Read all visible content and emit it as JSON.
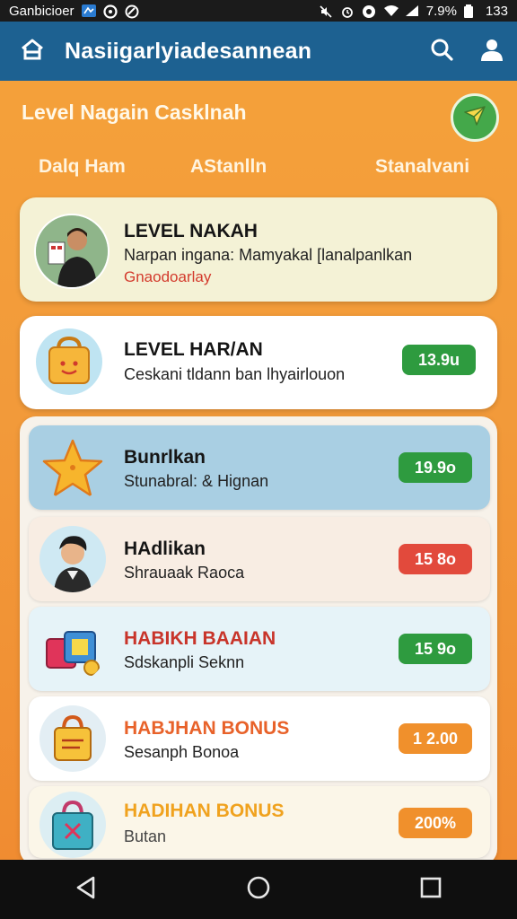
{
  "status_bar": {
    "left_text": "Ganbicioer",
    "right_text": "7.9%",
    "time": "133"
  },
  "app_bar": {
    "title": "Nasiigarlyiadesannean"
  },
  "page": {
    "header_title": "Level Nagain Casklnah"
  },
  "tabs": [
    {
      "label": "Dalq Ham"
    },
    {
      "label": "AStanlln"
    },
    {
      "label": "Stanalvani"
    }
  ],
  "profile_card": {
    "title": "LEVEL NAKAH",
    "subtitle": "Narpan ingana: Mamyakal [lanalpanlkan",
    "note": "Gnaodoarlay"
  },
  "level_card": {
    "title": "LEVEL HAR/AN",
    "subtitle": "Ceskani tldann ban lhyairlouon",
    "badge": "13.9u"
  },
  "rewards": [
    {
      "title": "Bunrlkan",
      "subtitle": "Stunabral: & Hignan",
      "badge": "19.9o"
    },
    {
      "title": "HAdlikan",
      "subtitle": "Shrauaak Raoca",
      "badge": "15 8o"
    },
    {
      "title": "HABIKH BAAIAN",
      "subtitle": "Sdskanpli Seknn",
      "badge": "15 9o"
    },
    {
      "title": "HABJHAN BONUS",
      "subtitle": "Sesanph Bonoa",
      "badge": "1 2.00"
    },
    {
      "title": "HADIHAN BONUS",
      "subtitle": "Butan",
      "badge": "200%"
    }
  ],
  "colors": {
    "app_bar": "#1d6191",
    "background": "#f29a3a",
    "badge_green": "#2e9b3f",
    "badge_red": "#e24a3c",
    "badge_orange": "#f0902c",
    "title_red": "#c8342a",
    "title_orange": "#e8622a",
    "title_gold": "#f0a21e"
  },
  "icons": {
    "home": "home-icon",
    "search": "search-icon",
    "user": "user-icon",
    "send": "send-icon",
    "back": "back-icon",
    "circle": "home-circle-icon",
    "square": "recents-icon"
  }
}
